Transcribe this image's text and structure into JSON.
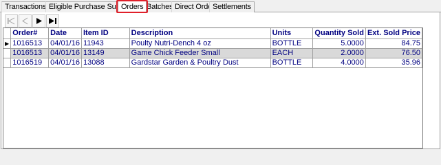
{
  "tabs": [
    {
      "label": "Transactions"
    },
    {
      "label": "Eligible Purchase Summaries"
    },
    {
      "label": "Orders"
    },
    {
      "label": "Batches"
    },
    {
      "label": "Direct Orders"
    },
    {
      "label": "Settlements"
    }
  ],
  "active_tab": "Orders",
  "toolbar": {
    "buttons": [
      "first-record-icon",
      "previous-record-icon",
      "next-record-icon",
      "last-record-icon"
    ]
  },
  "grid": {
    "columns": [
      "Order#",
      "Date",
      "Item ID",
      "Description",
      "Units",
      "Quantity Sold",
      "Ext. Sold Price"
    ],
    "rows": [
      [
        "1016513",
        "04/01/16",
        "11943",
        "Poulty Nutri-Dench 4 oz",
        "BOTTLE",
        "5.0000",
        "84.75"
      ],
      [
        "1016513",
        "04/01/16",
        "13149",
        "Game Chick Feeder Small",
        "EACH",
        "2.0000",
        "76.50"
      ],
      [
        "1016519",
        "04/01/16",
        "13088",
        "Gardstar Garden & Poultry Dust",
        "BOTTLE",
        "4.0000",
        "35.96"
      ]
    ],
    "current_row_marker": "▶"
  },
  "colors": {
    "accent": "#e0202a",
    "text_blue": "#000080",
    "alt_row": "#d9d9d9"
  }
}
